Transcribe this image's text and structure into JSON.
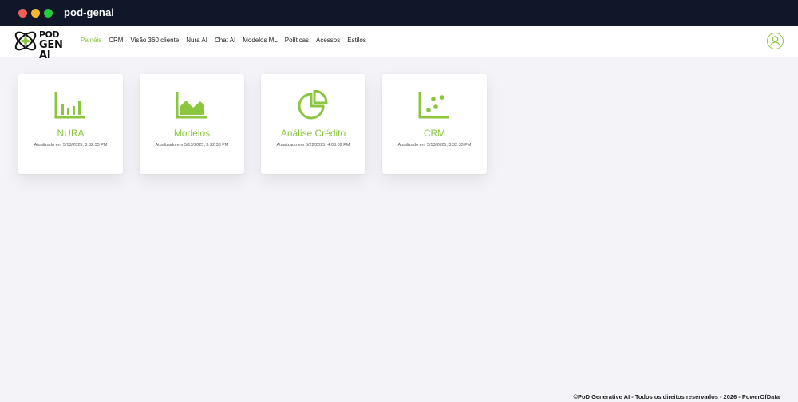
{
  "window": {
    "title": "pod-genai"
  },
  "logo": {
    "line1": "POD",
    "line2": "GEN AI"
  },
  "nav": {
    "items": [
      {
        "label": "Painéis",
        "active": true
      },
      {
        "label": "CRM"
      },
      {
        "label": "Visão 360 cliente"
      },
      {
        "label": "Nura AI"
      },
      {
        "label": "Chat AI"
      },
      {
        "label": "Modelos ML"
      },
      {
        "label": "Políticas"
      },
      {
        "label": "Acessos"
      },
      {
        "label": "Estilos"
      }
    ]
  },
  "cards": [
    {
      "title": "NURA",
      "updated": "Atualizado em 5/13/2025, 3:32:33 PM",
      "icon": "bar-chart-icon"
    },
    {
      "title": "Modelos",
      "updated": "Atualizado em 5/13/2025, 3:32:33 PM",
      "icon": "area-chart-icon"
    },
    {
      "title": "Análise Crédito",
      "updated": "Atualizado em 5/22/2025, 4:08:09 PM",
      "icon": "pie-chart-icon"
    },
    {
      "title": "CRM",
      "updated": "Atualizado em 5/13/2025, 3:32:33 PM",
      "icon": "scatter-chart-icon"
    }
  ],
  "footer": {
    "text": "©PoD Generative AI - Todos os direitos reservados - 2026 - PowerOfData"
  },
  "colors": {
    "accent": "#8cc63f",
    "titlebar": "#101729",
    "background": "#f4f3f7"
  }
}
